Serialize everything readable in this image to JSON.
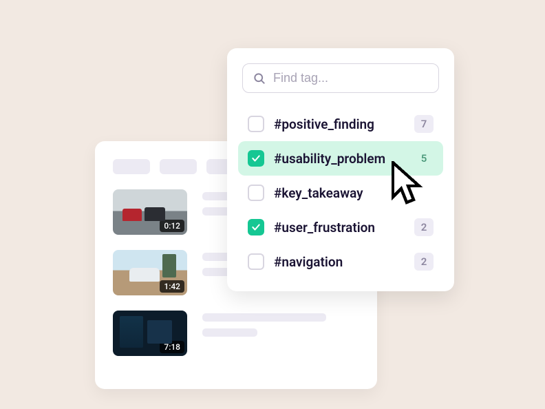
{
  "search": {
    "placeholder": "Find tag..."
  },
  "tags": [
    {
      "label": "#positive_finding",
      "count": "7",
      "checked": false,
      "highlight": false
    },
    {
      "label": "#usability_problem",
      "count": "5",
      "checked": true,
      "highlight": true
    },
    {
      "label": "#key_takeaway",
      "count": "",
      "checked": false,
      "highlight": false
    },
    {
      "label": "#user_frustration",
      "count": "2",
      "checked": true,
      "highlight": false
    },
    {
      "label": "#navigation",
      "count": "2",
      "checked": false,
      "highlight": false
    }
  ],
  "videos": [
    {
      "duration": "0:12"
    },
    {
      "duration": "1:42"
    },
    {
      "duration": "7:18"
    }
  ]
}
